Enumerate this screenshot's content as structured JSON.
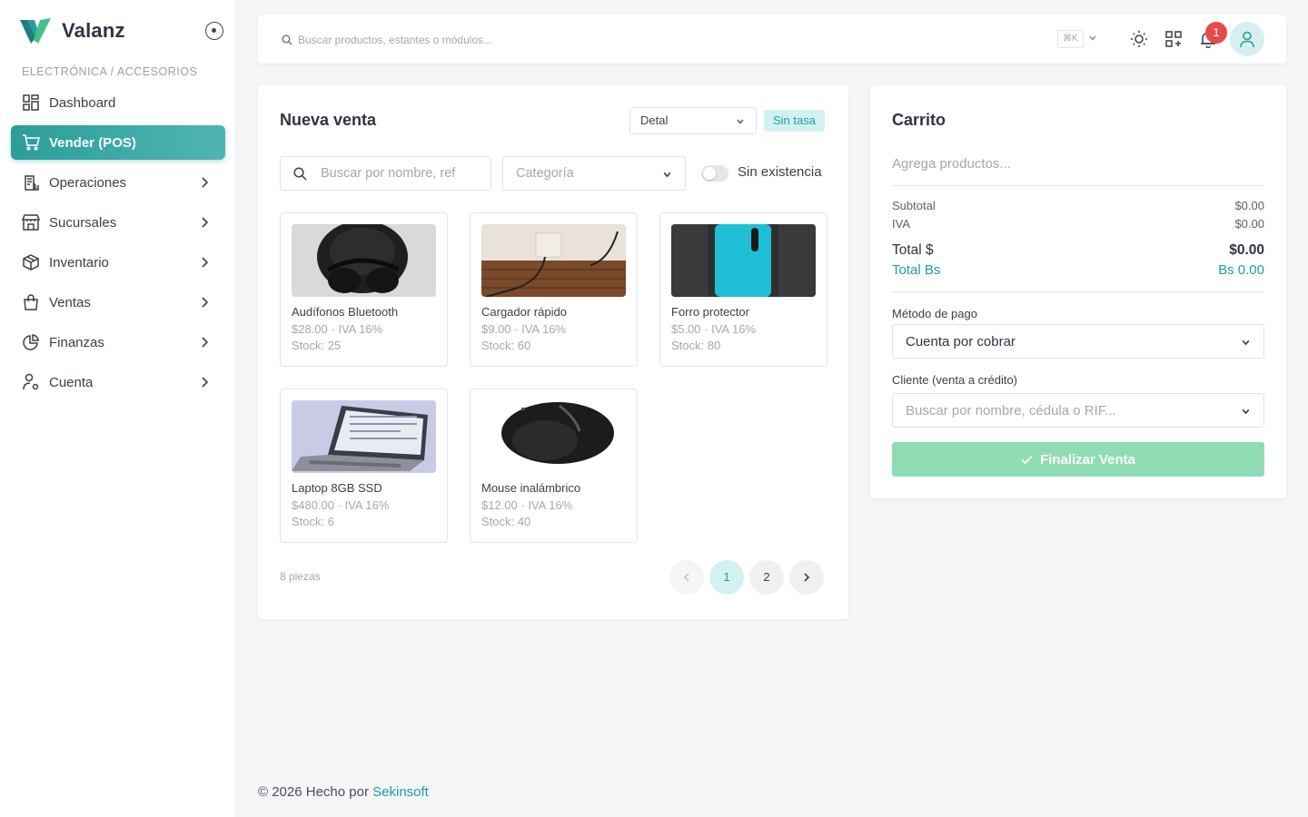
{
  "brand": {
    "name": "Valanz"
  },
  "sidebar": {
    "section": "ELECTRÓNICA / ACCESORIOS",
    "items": [
      {
        "label": "Dashboard",
        "icon": "grid-icon",
        "active": false,
        "expandable": false
      },
      {
        "label": "Vender (POS)",
        "icon": "cart-icon",
        "active": true,
        "expandable": false
      },
      {
        "label": "Operaciones",
        "icon": "receipt-icon",
        "active": false,
        "expandable": true
      },
      {
        "label": "Sucursales",
        "icon": "store-icon",
        "active": false,
        "expandable": true
      },
      {
        "label": "Inventario",
        "icon": "box-icon",
        "active": false,
        "expandable": true
      },
      {
        "label": "Ventas",
        "icon": "bag-icon",
        "active": false,
        "expandable": true
      },
      {
        "label": "Finanzas",
        "icon": "pie-chart-icon",
        "active": false,
        "expandable": true
      },
      {
        "label": "Cuenta",
        "icon": "user-gear-icon",
        "active": false,
        "expandable": true
      }
    ]
  },
  "topbar": {
    "search_placeholder": "Buscar productos, estantes o módulos...",
    "shortcut": "⌘K",
    "notifications": "1"
  },
  "sale": {
    "title": "Nueva venta",
    "price_list": "Detal",
    "rate_badge": "Sin tasa",
    "search_placeholder": "Buscar por nombre, ref",
    "category_placeholder": "Categoría",
    "stock_toggle_label": "Sin existencia",
    "products": [
      {
        "name": "Audífonos Bluetooth",
        "price": "$28.00 · IVA 16%",
        "stock": "Stock: 25",
        "image": "headphones"
      },
      {
        "name": "Cargador rápido",
        "price": "$9.00 · IVA 16%",
        "stock": "Stock: 60",
        "image": "charger"
      },
      {
        "name": "Forro protector",
        "price": "$5.00 · IVA 16%",
        "stock": "Stock: 80",
        "image": "case"
      },
      {
        "name": "Laptop 8GB SSD",
        "price": "$480.00 · IVA 16%",
        "stock": "Stock: 6",
        "image": "laptop"
      },
      {
        "name": "Mouse inalámbrico",
        "price": "$12.00 · IVA 16%",
        "stock": "Stock: 40",
        "image": "mouse"
      }
    ],
    "pieces": "8 piezas",
    "pages": [
      "1",
      "2"
    ],
    "current_page": "1"
  },
  "cart": {
    "title": "Carrito",
    "empty": "Agrega productos...",
    "subtotal_label": "Subtotal",
    "subtotal": "$0.00",
    "iva_label": "IVA",
    "iva": "$0.00",
    "total_label": "Total $",
    "total": "$0.00",
    "total_bs_label": "Total Bs",
    "total_bs": "Bs 0.00",
    "payment_label": "Método de pago",
    "payment_value": "Cuenta por cobrar",
    "client_label": "Cliente (venta a crédito)",
    "client_placeholder": "Buscar por nombre, cédula o RIF...",
    "finish_label": "Finalizar Venta"
  },
  "footer": {
    "text": "© 2026 Hecho por",
    "link": "Sekinsoft"
  },
  "colors": {
    "accent": "#2b9e9a",
    "accent_light": "#d4f1f2",
    "success_button": "#8fdcb4",
    "badge": "#e84a4a"
  }
}
